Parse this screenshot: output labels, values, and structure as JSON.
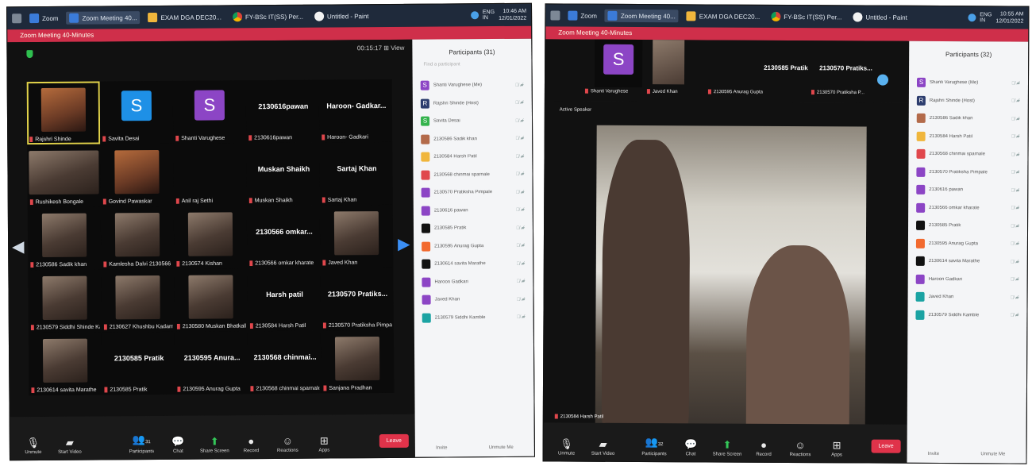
{
  "left": {
    "taskbar": {
      "apps": [
        "Zoom",
        "Zoom Meeting 40...",
        "EXAM DGA DEC20...",
        "FY-BSc IT(SS) Per...",
        "Untitled - Paint"
      ],
      "tray": {
        "lang": "ENG",
        "lang2": "IN",
        "time": "10:46 AM",
        "date": "12/01/2022"
      }
    },
    "window_title": "Zoom Meeting 40-Minutes",
    "gallery_top": "00:15:17  ⊞ View",
    "tiles": [
      {
        "kind": "photo",
        "name": "Rajshri Shinde",
        "speaking": true,
        "warm": true
      },
      {
        "kind": "avatar",
        "letter": "S",
        "color": "#1e90e6",
        "name": "Savita Desai"
      },
      {
        "kind": "avatar",
        "letter": "S",
        "color": "#8c45c5",
        "name": "Shanti Varughese"
      },
      {
        "kind": "text",
        "headline": "2130616pawan",
        "name": "2130616pawan"
      },
      {
        "kind": "text",
        "headline": "Haroon- Gadkar...",
        "name": "Haroon- Gadkari"
      },
      {
        "kind": "photo",
        "name": "Rushikesh Bongale",
        "wide": true
      },
      {
        "kind": "photo",
        "name": "Govind Pawaskar",
        "warm": true
      },
      {
        "kind": "blank",
        "name": "Anil raj Sethi"
      },
      {
        "kind": "text",
        "headline": "Muskan Shaikh",
        "name": "Muskan Shaikh"
      },
      {
        "kind": "text",
        "headline": "Sartaj Khan",
        "name": "Sartaj Khan"
      },
      {
        "kind": "photo",
        "name": "2130586 Sadik khan"
      },
      {
        "kind": "photo",
        "name": "Kamlesha Dalvi 2130566"
      },
      {
        "kind": "photo",
        "name": "2130574 Kishan"
      },
      {
        "kind": "text",
        "headline": "2130566 omkar...",
        "name": "2130566 omkar kharate"
      },
      {
        "kind": "photo",
        "name": "Javed Khan"
      },
      {
        "kind": "photo",
        "name": "2130579 Siddhi Shinde Kamble"
      },
      {
        "kind": "photo",
        "name": "2130627 Khushbu Kadam"
      },
      {
        "kind": "photo",
        "name": "2130580 Muskan Bhatkalkar"
      },
      {
        "kind": "text",
        "headline": "Harsh patil",
        "name": "2130584 Harsh Patil"
      },
      {
        "kind": "text",
        "headline": "2130570 Pratiks...",
        "name": "2130570 Pratiksha Pimpale"
      },
      {
        "kind": "photo",
        "name": "2130614 savita Marathe"
      },
      {
        "kind": "text",
        "headline": "2130585 Pratik",
        "name": "2130585 Pratik"
      },
      {
        "kind": "text",
        "headline": "2130595 Anura...",
        "name": "2130595 Anurag Gupta"
      },
      {
        "kind": "text",
        "headline": "2130568 chinmai...",
        "name": "2130568 chinmai sparnale"
      },
      {
        "kind": "photo",
        "name": "Sanjana Pradhan"
      }
    ],
    "controls": [
      "Unmute",
      "Start Video",
      "Participants",
      "Chat",
      "Share Screen",
      "Record",
      "Reactions",
      "Apps"
    ],
    "participants_count": "31",
    "leave": "Leave",
    "panel": {
      "title": "Participants (31)",
      "search": "Find a participant",
      "rows": [
        {
          "letter": "S",
          "color": "#8c45c5",
          "name": "Shanti Varughese (Me)"
        },
        {
          "letter": "R",
          "color": "#2d3d6e",
          "name": "Rajshri Shinde (Host)"
        },
        {
          "letter": "S",
          "color": "#34b34d",
          "name": "Savita Desai"
        },
        {
          "letter": "",
          "color": "#b36a4a",
          "name": "2130586 Sadik khan"
        },
        {
          "letter": "",
          "color": "#f0b63c",
          "name": "2130584 Harsh Patil"
        },
        {
          "letter": "",
          "color": "#e0474c",
          "name": "2130568 chinmai sparnale"
        },
        {
          "letter": "",
          "color": "#8c45c5",
          "name": "2130570 Pratiksha Pimpale"
        },
        {
          "letter": "",
          "color": "#8c45c5",
          "name": "2130616 pawan"
        },
        {
          "letter": "",
          "color": "#111",
          "name": "2130585 Pratik"
        },
        {
          "letter": "",
          "color": "#f26a2f",
          "name": "2130595 Anurag Gupta"
        },
        {
          "letter": "",
          "color": "#111",
          "name": "2130614 savita Marathe"
        },
        {
          "letter": "",
          "color": "#8c45c5",
          "name": "Haroon Gadkari"
        },
        {
          "letter": "",
          "color": "#8c45c5",
          "name": "Javed Khan"
        },
        {
          "letter": "",
          "color": "#1ba3a3",
          "name": "2130579 Siddhi Kamble"
        }
      ],
      "invite": "Invite",
      "unmute": "Unmute Me"
    }
  },
  "right": {
    "taskbar": {
      "apps": [
        "Zoom",
        "Zoom Meeting 40...",
        "EXAM DGA DEC20...",
        "FY-BSc IT(SS) Per...",
        "Untitled - Paint"
      ],
      "tray": {
        "lang": "ENG",
        "lang2": "IN",
        "time": "10:55 AM",
        "date": "12/01/2022"
      }
    },
    "window_title": "Zoom Meeting 40-Minutes",
    "strip": [
      {
        "kind": "avatar",
        "letter": "S",
        "name": "Shanti Varughese"
      },
      {
        "kind": "photo",
        "name": "Javed Khan"
      },
      {
        "kind": "text",
        "headline": "2130585 Pratik",
        "name": "2130595 Anurag Gupta"
      },
      {
        "kind": "text",
        "headline": "2130570 Pratiks...",
        "name": "2130570 Pratiksha P..."
      }
    ],
    "speaker_label": "Active Speaker",
    "speaker_video_name": "2130584 Harsh Patil",
    "controls": [
      "Unmute",
      "Start Video",
      "Participants",
      "Chat",
      "Share Screen",
      "Record",
      "Reactions",
      "Apps"
    ],
    "participants_count": "32",
    "leave": "Leave",
    "panel": {
      "title": "Participants (32)",
      "rows": [
        {
          "letter": "S",
          "color": "#8c45c5",
          "name": "Shanti Varughese (Me)"
        },
        {
          "letter": "R",
          "color": "#2d3d6e",
          "name": "Rajshri Shinde (Host)"
        },
        {
          "letter": "",
          "color": "#b36a4a",
          "name": "2130586 Sadik khan"
        },
        {
          "letter": "",
          "color": "#f0b63c",
          "name": "2130584 Harsh Patil"
        },
        {
          "letter": "",
          "color": "#e0474c",
          "name": "2130568 chinmai sparnale"
        },
        {
          "letter": "",
          "color": "#8c45c5",
          "name": "2130570 Pratiksha Pimpale"
        },
        {
          "letter": "",
          "color": "#8c45c5",
          "name": "2130616 pawan"
        },
        {
          "letter": "",
          "color": "#8c45c5",
          "name": "2130566 omkar kharate"
        },
        {
          "letter": "",
          "color": "#111",
          "name": "2130585 Pratik"
        },
        {
          "letter": "",
          "color": "#f26a2f",
          "name": "2130595 Anurag Gupta"
        },
        {
          "letter": "",
          "color": "#111",
          "name": "2130614 savita Marathe"
        },
        {
          "letter": "",
          "color": "#8c45c5",
          "name": "Haroon Gadkari"
        },
        {
          "letter": "",
          "color": "#1ba3a3",
          "name": "Javed Khan"
        },
        {
          "letter": "",
          "color": "#1ba3a3",
          "name": "2130579 Siddhi Kamble"
        }
      ],
      "invite": "Invite",
      "unmute": "Unmute Me"
    }
  }
}
